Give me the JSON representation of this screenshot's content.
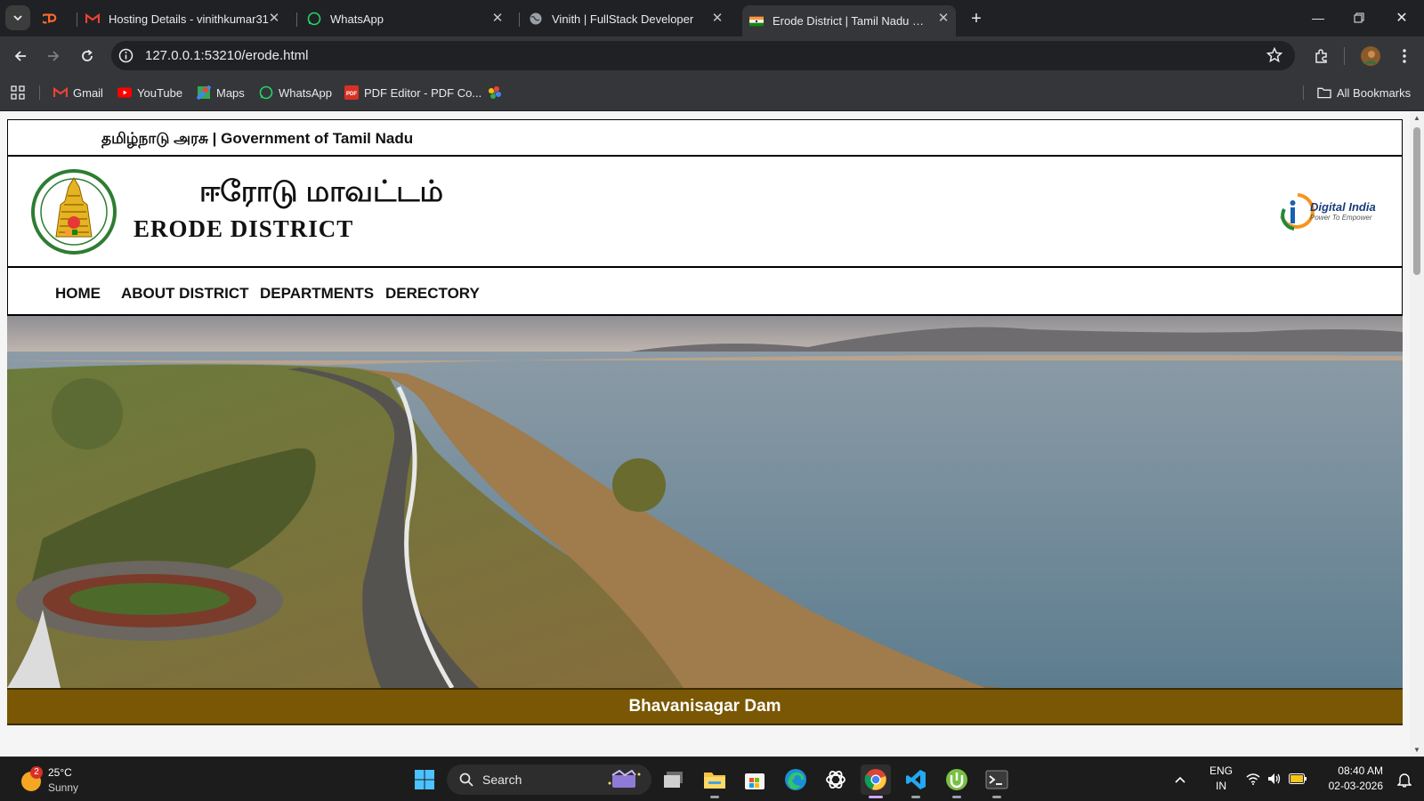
{
  "browser": {
    "tabs": [
      {
        "title": "",
        "icon": "cpanel-icon"
      },
      {
        "title": "Hosting Details - vinithkumar31",
        "icon": "gmail-icon"
      },
      {
        "title": "WhatsApp",
        "icon": "whatsapp-icon"
      },
      {
        "title": "Vinith | FullStack Developer",
        "icon": "globe-icon"
      },
      {
        "title": "Erode District | Tamil Nadu | Tur",
        "icon": "india-flag-icon",
        "active": true
      }
    ],
    "url": "127.0.0.1:53210/erode.html",
    "bookmarks": [
      {
        "label": "Gmail",
        "icon": "gmail-icon"
      },
      {
        "label": "YouTube",
        "icon": "youtube-icon"
      },
      {
        "label": "Maps",
        "icon": "maps-icon"
      },
      {
        "label": "WhatsApp",
        "icon": "whatsapp-icon"
      },
      {
        "label": "PDF Editor - PDF Co...",
        "icon": "pdf-icon"
      },
      {
        "label": "",
        "icon": "photos-icon"
      }
    ],
    "all_bookmarks": "All Bookmarks"
  },
  "site": {
    "gov_line": "தமிழ்நாடு அரசு | Government of Tamil Nadu",
    "title_tamil": "ஈரோடு மாவட்டம்",
    "title_english": "ERODE DISTRICT",
    "digital_india": {
      "title": "Digital India",
      "tagline": "Power To Empower"
    },
    "nav": [
      "HOME",
      "ABOUT DISTRICT",
      "DEPARTMENTS",
      "DERECTORY"
    ],
    "hero_caption": "Bhavanisagar Dam"
  },
  "taskbar": {
    "weather": {
      "temp": "25°C",
      "condition": "Sunny",
      "badge": "2"
    },
    "search_label": "Search",
    "lang_top": "ENG",
    "lang_bottom": "IN",
    "time": "08:40 AM",
    "date": "02-03-2026"
  }
}
